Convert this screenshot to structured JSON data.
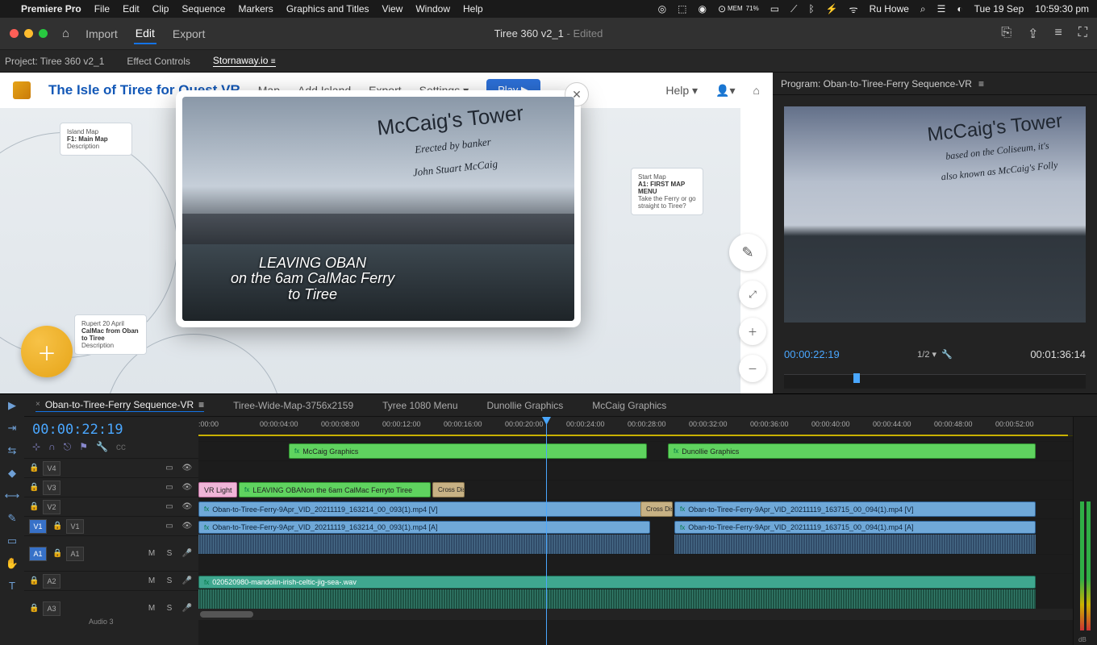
{
  "macmenu": {
    "app": "Premiere Pro",
    "items": [
      "File",
      "Edit",
      "Clip",
      "Sequence",
      "Markers",
      "Graphics and Titles",
      "View",
      "Window",
      "Help"
    ],
    "mem_label": "MEM",
    "mem_pct": "71%",
    "user": "Ru Howe",
    "date": "Tue 19 Sep",
    "time": "10:59:30 pm"
  },
  "chrome": {
    "tabs": [
      "Import",
      "Edit",
      "Export"
    ],
    "active_tab": "Edit",
    "title": "Tiree 360 v2_1",
    "edited": " - Edited"
  },
  "panel_tabs": {
    "project": "Project: Tiree 360 v2_1",
    "effect": "Effect Controls",
    "stornaway": "Stornaway.io"
  },
  "stornaway": {
    "title": "The Isle of Tiree for Quest VR",
    "nav": [
      "Map",
      "Add Island",
      "Export",
      "Settings ▾"
    ],
    "play": "Play ▶",
    "help": "Help ▾",
    "nodes": {
      "n1_header": "Island Map",
      "n1_title": "F1: Main Map",
      "n1_desc": "Description",
      "n2_header": "Rupert 20 April",
      "n2_title": "CalMac from Oban to Tiree",
      "n2_desc": "Description",
      "n3_header": "Start Map",
      "n3_title": "A1: FIRST MAP MENU",
      "n3_desc": "Take the Ferry or go straight to Tiree?"
    }
  },
  "modal": {
    "tower": "McCaig's Tower",
    "tower_sub1": "Erected by banker",
    "tower_sub2": "John Stuart McCaig",
    "leaving1": "LEAVING OBAN",
    "leaving2": "on the 6am CalMac Ferry",
    "leaving3": "to Tiree"
  },
  "program": {
    "tab": "Program: Oban-to-Tiree-Ferry Sequence-VR",
    "tower": "McCaig's Tower",
    "sub1": "based on the Coliseum, it's",
    "sub2": "also known as McCaig's Folly",
    "current": "00:00:22:19",
    "zoom": "1/2",
    "duration": "00:01:36:14"
  },
  "seq_tabs": [
    "Oban-to-Tiree-Ferry Sequence-VR",
    "Tiree-Wide-Map-3756x2159",
    "Tyree 1080 Menu",
    "Dunollie Graphics",
    "McCaig Graphics"
  ],
  "timeline": {
    "tc": "00:00:22:19",
    "ticks": [
      ":00:00",
      "00:00:04:00",
      "00:00:08:00",
      "00:00:12:00",
      "00:00:16:00",
      "00:00:20:00",
      "00:00:24:00",
      "00:00:28:00",
      "00:00:32:00",
      "00:00:36:00",
      "00:00:40:00",
      "00:00:44:00",
      "00:00:48:00",
      "00:00:52:00"
    ],
    "tracks_v": [
      "V4",
      "V3",
      "V2",
      "V1"
    ],
    "tracks_v_target": "V1",
    "tracks_a": [
      "A1",
      "A2",
      "A3"
    ],
    "tracks_a_target": "A1",
    "audio3_label": "Audio 3",
    "clips": {
      "mccaig": "McCaig Graphics",
      "dunollie": "Dunollie Graphics",
      "vrlight": "VR Light",
      "leaving": "LEAVING OBANon the 6am CalMac Ferryto Tiree",
      "crossdis": "Cross Dis",
      "v1a": "Oban-to-Tiree-Ferry-9Apr_VID_20211119_163214_00_093(1).mp4 [V]",
      "v1b": "Oban-to-Tiree-Ferry-9Apr_VID_20211119_163715_00_094(1).mp4 [V]",
      "a1a": "Oban-to-Tiree-Ferry-9Apr_VID_20211119_163214_00_093(1).mp4 [A]",
      "a1b": "Oban-to-Tiree-Ferry-9Apr_VID_20211119_163715_00_094(1).mp4 [A]",
      "music": "020520980-mandolin-irish-celtic-jig-sea-.wav"
    }
  },
  "meters": {
    "db": "dB"
  }
}
